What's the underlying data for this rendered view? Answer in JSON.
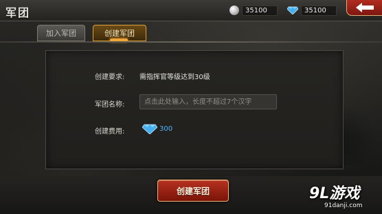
{
  "header": {
    "title": "军团",
    "silver": {
      "icon": "silver-coin-icon",
      "value": "35100"
    },
    "diamond": {
      "icon": "diamond-icon",
      "value": "35100"
    },
    "back_icon": "back-arrow-icon"
  },
  "tabs": [
    {
      "label": "加入军团",
      "active": false
    },
    {
      "label": "创建军团",
      "active": true
    }
  ],
  "form": {
    "requirement_label": "创建要求:",
    "requirement_value": "需指挥官等级达到30级",
    "name_label": "军团名称:",
    "name_placeholder": "点击此处输入，长度不超过7个汉字",
    "name_value": "",
    "fee_label": "创建费用:",
    "fee_icon": "diamond-icon",
    "fee_value": "300"
  },
  "create_button": {
    "label": "创建军团"
  },
  "watermark": {
    "logo": "9L游戏",
    "url": "91danji.com"
  },
  "colors": {
    "accent_gold": "#d9a23c",
    "button_red": "#b63220",
    "diamond_blue": "#4ab4ff"
  }
}
